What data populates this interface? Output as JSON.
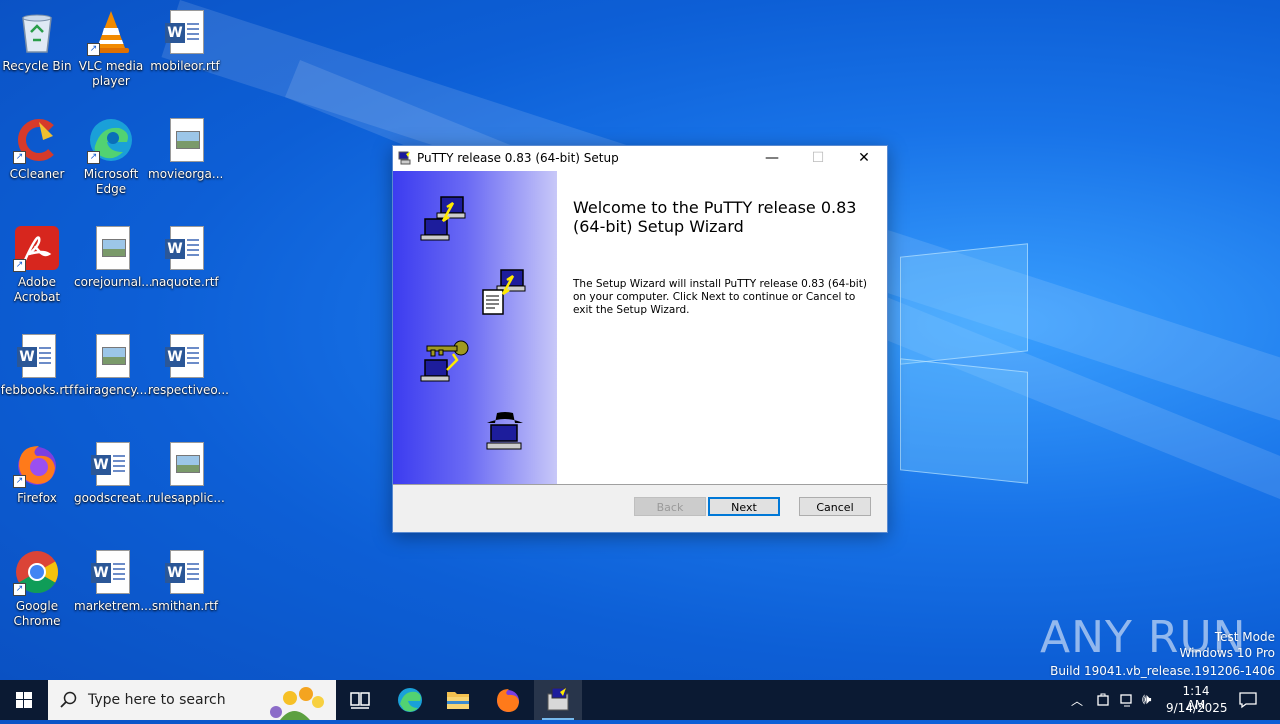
{
  "desktop": {
    "icons": [
      {
        "label": "Recycle Bin"
      },
      {
        "label": "VLC media player"
      },
      {
        "label": "mobileor.rtf"
      },
      {
        "label": "CCleaner"
      },
      {
        "label": "Microsoft Edge"
      },
      {
        "label": "movieorga..."
      },
      {
        "label": "Adobe Acrobat"
      },
      {
        "label": "corejournal..."
      },
      {
        "label": "naquote.rtf"
      },
      {
        "label": "febbooks.rtf"
      },
      {
        "label": "fairagency...."
      },
      {
        "label": "respectiveo..."
      },
      {
        "label": "Firefox"
      },
      {
        "label": "goodscreat..."
      },
      {
        "label": "rulesapplic..."
      },
      {
        "label": "Google Chrome"
      },
      {
        "label": "marketrem..."
      },
      {
        "label": "smithan.rtf"
      }
    ]
  },
  "dialog": {
    "title": "PuTTY release 0.83 (64-bit) Setup",
    "heading": "Welcome to the PuTTY release 0.83 (64-bit) Setup Wizard",
    "description": "The Setup Wizard will install PuTTY release 0.83 (64-bit) on your computer. Click Next to continue or Cancel to exit the Setup Wizard.",
    "buttons": {
      "back": "Back",
      "next": "Next",
      "cancel": "Cancel"
    },
    "window_controls": {
      "minimize": "—",
      "maximize": "☐",
      "close": "✕"
    }
  },
  "watermark": {
    "brand": "ANY RUN",
    "line1": "Test Mode",
    "line2": "Windows 10 Pro",
    "line3": "Build 19041.vb_release.191206-1406"
  },
  "taskbar": {
    "search_placeholder": "Type here to search",
    "time": "1:14 AM",
    "date": "9/14/2025"
  },
  "colors": {
    "accent": "#0078d7",
    "taskbar": "#0b1a33",
    "banner_start": "#3c3cf0",
    "banner_end": "#c8c8f8"
  }
}
